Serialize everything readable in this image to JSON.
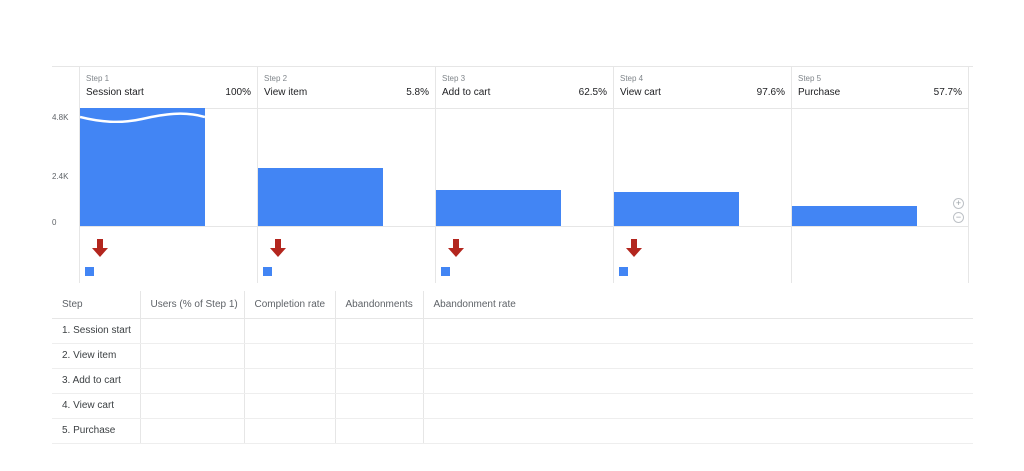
{
  "chart_data": {
    "type": "bar",
    "categories": [
      "Session start",
      "View item",
      "Add to cart",
      "View cart",
      "Purchase"
    ],
    "step_numbers": [
      "Step 1",
      "Step 2",
      "Step 3",
      "Step 4",
      "Step 5"
    ],
    "rates": [
      "100%",
      "5.8%",
      "62.5%",
      "97.6%",
      "57.7%"
    ],
    "values": [
      4800,
      2350,
      1450,
      1400,
      800
    ],
    "y_ticks": [
      "4.8K",
      "2.4K",
      "0"
    ],
    "ylim": [
      0,
      4800
    ],
    "axis_break_on_first_bar": true,
    "bar_color": "#4285f4",
    "drop_arrow_color": "#b3261e"
  },
  "controls": {
    "zoom_in": "+",
    "zoom_out": "−"
  },
  "table": {
    "headers": [
      "Step",
      "Users (% of Step 1)",
      "Completion rate",
      "Abandonments",
      "Abandonment rate"
    ],
    "rows": [
      "1. Session start",
      "2. View item",
      "3. Add to cart",
      "4. View cart",
      "5. Purchase"
    ]
  }
}
